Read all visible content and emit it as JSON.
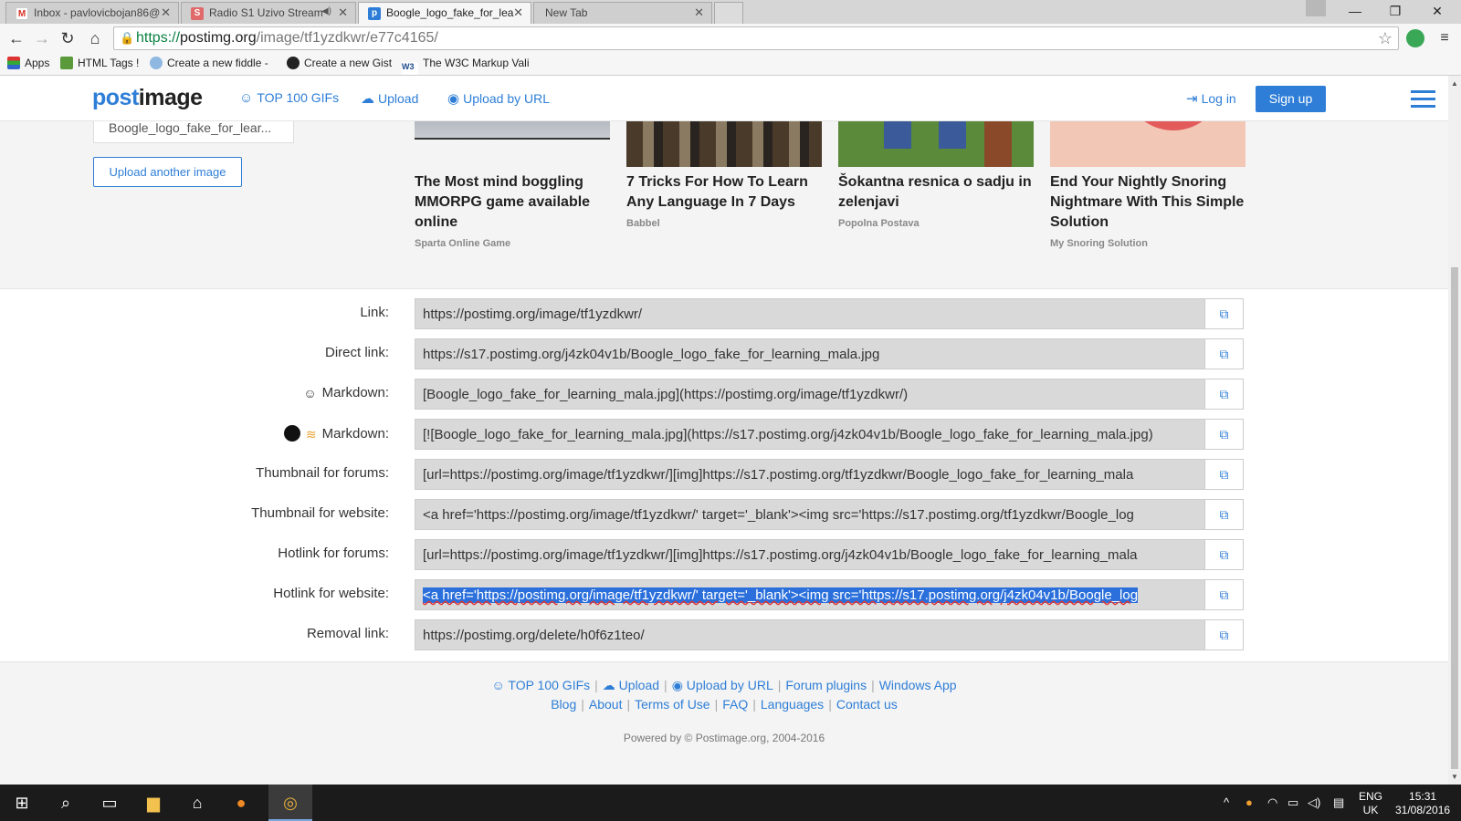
{
  "browser": {
    "tabs": [
      {
        "title": "Inbox - pavlovicbojan86@",
        "icon": "gmail-icon"
      },
      {
        "title": "Radio S1 Uzivo Stream",
        "icon": "radio-icon",
        "audio": "◀)"
      },
      {
        "title": "Boogle_logo_fake_for_lea",
        "icon": "postimage-icon"
      },
      {
        "title": "New Tab",
        "icon": ""
      }
    ],
    "url": {
      "scheme": "https://",
      "host": "postimg.org",
      "path": "/image/tf1yzdkwr/e77c4165/"
    },
    "bookmarks": [
      "Apps",
      "HTML Tags !",
      "Create a new fiddle -",
      "Create a new Gist",
      "The W3C Markup Vali"
    ]
  },
  "header": {
    "logo_a": "post",
    "logo_b": "image",
    "nav": [
      "TOP 100 GIFs",
      "Upload",
      "Upload by URL"
    ],
    "login": "Log in",
    "signup": "Sign up"
  },
  "upload": {
    "filename": "Boogle_logo_fake_for_lear...",
    "upload_another": "Upload another image"
  },
  "ads": [
    {
      "title": "The Most mind boggling MMORPG game available online",
      "source": "Sparta Online Game"
    },
    {
      "title": "7 Tricks For How To Learn Any Language In 7 Days",
      "source": "Babbel"
    },
    {
      "title": "Šokantna resnica o sadju in zelenjavi",
      "source": "Popolna Postava"
    },
    {
      "title": "End Your Nightly Snoring Nightmare With This Simple Solution",
      "source": "My Snoring Solution"
    }
  ],
  "codes": [
    {
      "label": "Link:",
      "value": "https://postimg.org/image/tf1yzdkwr/"
    },
    {
      "label": "Direct link:",
      "value": "https://s17.postimg.org/j4zk04v1b/Boogle_logo_fake_for_learning_mala.jpg"
    },
    {
      "label": "Markdown:",
      "value": "[Boogle_logo_fake_for_learning_mala.jpg](https://postimg.org/image/tf1yzdkwr/)"
    },
    {
      "label": "Markdown:",
      "value": "[![Boogle_logo_fake_for_learning_mala.jpg](https://s17.postimg.org/j4zk04v1b/Boogle_logo_fake_for_learning_mala.jpg)"
    },
    {
      "label": "Thumbnail for forums:",
      "value": "[url=https://postimg.org/image/tf1yzdkwr/][img]https://s17.postimg.org/tf1yzdkwr/Boogle_logo_fake_for_learning_mala"
    },
    {
      "label": "Thumbnail for website:",
      "value": "<a href='https://postimg.org/image/tf1yzdkwr/' target='_blank'><img src='https://s17.postimg.org/tf1yzdkwr/Boogle_log"
    },
    {
      "label": "Hotlink for forums:",
      "value": "[url=https://postimg.org/image/tf1yzdkwr/][img]https://s17.postimg.org/j4zk04v1b/Boogle_logo_fake_for_learning_mala"
    },
    {
      "label": "Hotlink for website:",
      "value": "<a href='https://postimg.org/image/tf1yzdkwr/' target='_blank'><img src='https://s17.postimg.org/j4zk04v1b/Boogle_log"
    },
    {
      "label": "Removal link:",
      "value": "https://postimg.org/delete/h0f6z1teo/"
    }
  ],
  "footer": {
    "row1": [
      "TOP 100 GIFs",
      "Upload",
      "Upload by URL",
      "Forum plugins",
      "Windows App"
    ],
    "row2": [
      "Blog",
      "About",
      "Terms of Use",
      "FAQ",
      "Languages",
      "Contact us"
    ],
    "powered": "Powered by © Postimage.org, 2004-2016"
  },
  "taskbar": {
    "lang": "ENG",
    "region": "UK",
    "time": "15:31",
    "date": "31/08/2016"
  },
  "colors": {
    "brand_blue": "#2e7ed7",
    "selection": "#2a6fdb"
  }
}
